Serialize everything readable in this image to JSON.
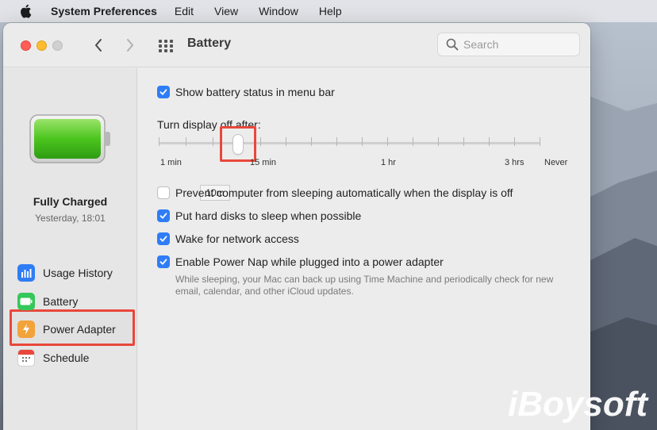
{
  "menubar": {
    "app_name": "System Preferences",
    "items": [
      "Edit",
      "View",
      "Window",
      "Help"
    ]
  },
  "window": {
    "title": "Battery",
    "search_placeholder": "Search"
  },
  "sidebar": {
    "status_title": "Fully Charged",
    "status_time": "Yesterday, 18:01",
    "battery_level_fraction": 1.0,
    "items": [
      {
        "label": "Usage History",
        "icon": "chart-bars-icon",
        "color": "#2f7df6"
      },
      {
        "label": "Battery",
        "icon": "battery-icon",
        "color": "#34c759"
      },
      {
        "label": "Power Adapter",
        "icon": "bolt-icon",
        "color": "#f2a33a",
        "selected": true
      },
      {
        "label": "Schedule",
        "icon": "calendar-icon",
        "color": "#e8473b"
      }
    ]
  },
  "main": {
    "show_battery_status": {
      "label": "Show battery status in menu bar",
      "checked": true
    },
    "display_off": {
      "label": "Turn display off after:",
      "value_label": "10m",
      "tick_labels": [
        "1 min",
        "15 min",
        "1 hr",
        "3 hrs",
        "Never"
      ]
    },
    "options": [
      {
        "label": "Prevent computer from sleeping automatically when the display is off",
        "checked": false
      },
      {
        "label": "Put hard disks to sleep when possible",
        "checked": true
      },
      {
        "label": "Wake for network access",
        "checked": true
      },
      {
        "label": "Enable Power Nap while plugged into a power adapter",
        "checked": true
      }
    ],
    "power_nap_description": "While sleeping, your Mac can back up using Time Machine and periodically check for new email, calendar, and other iCloud updates."
  },
  "watermark": "iBoysoft",
  "colors": {
    "accent": "#2f7df6",
    "highlight": "#e8473b"
  }
}
